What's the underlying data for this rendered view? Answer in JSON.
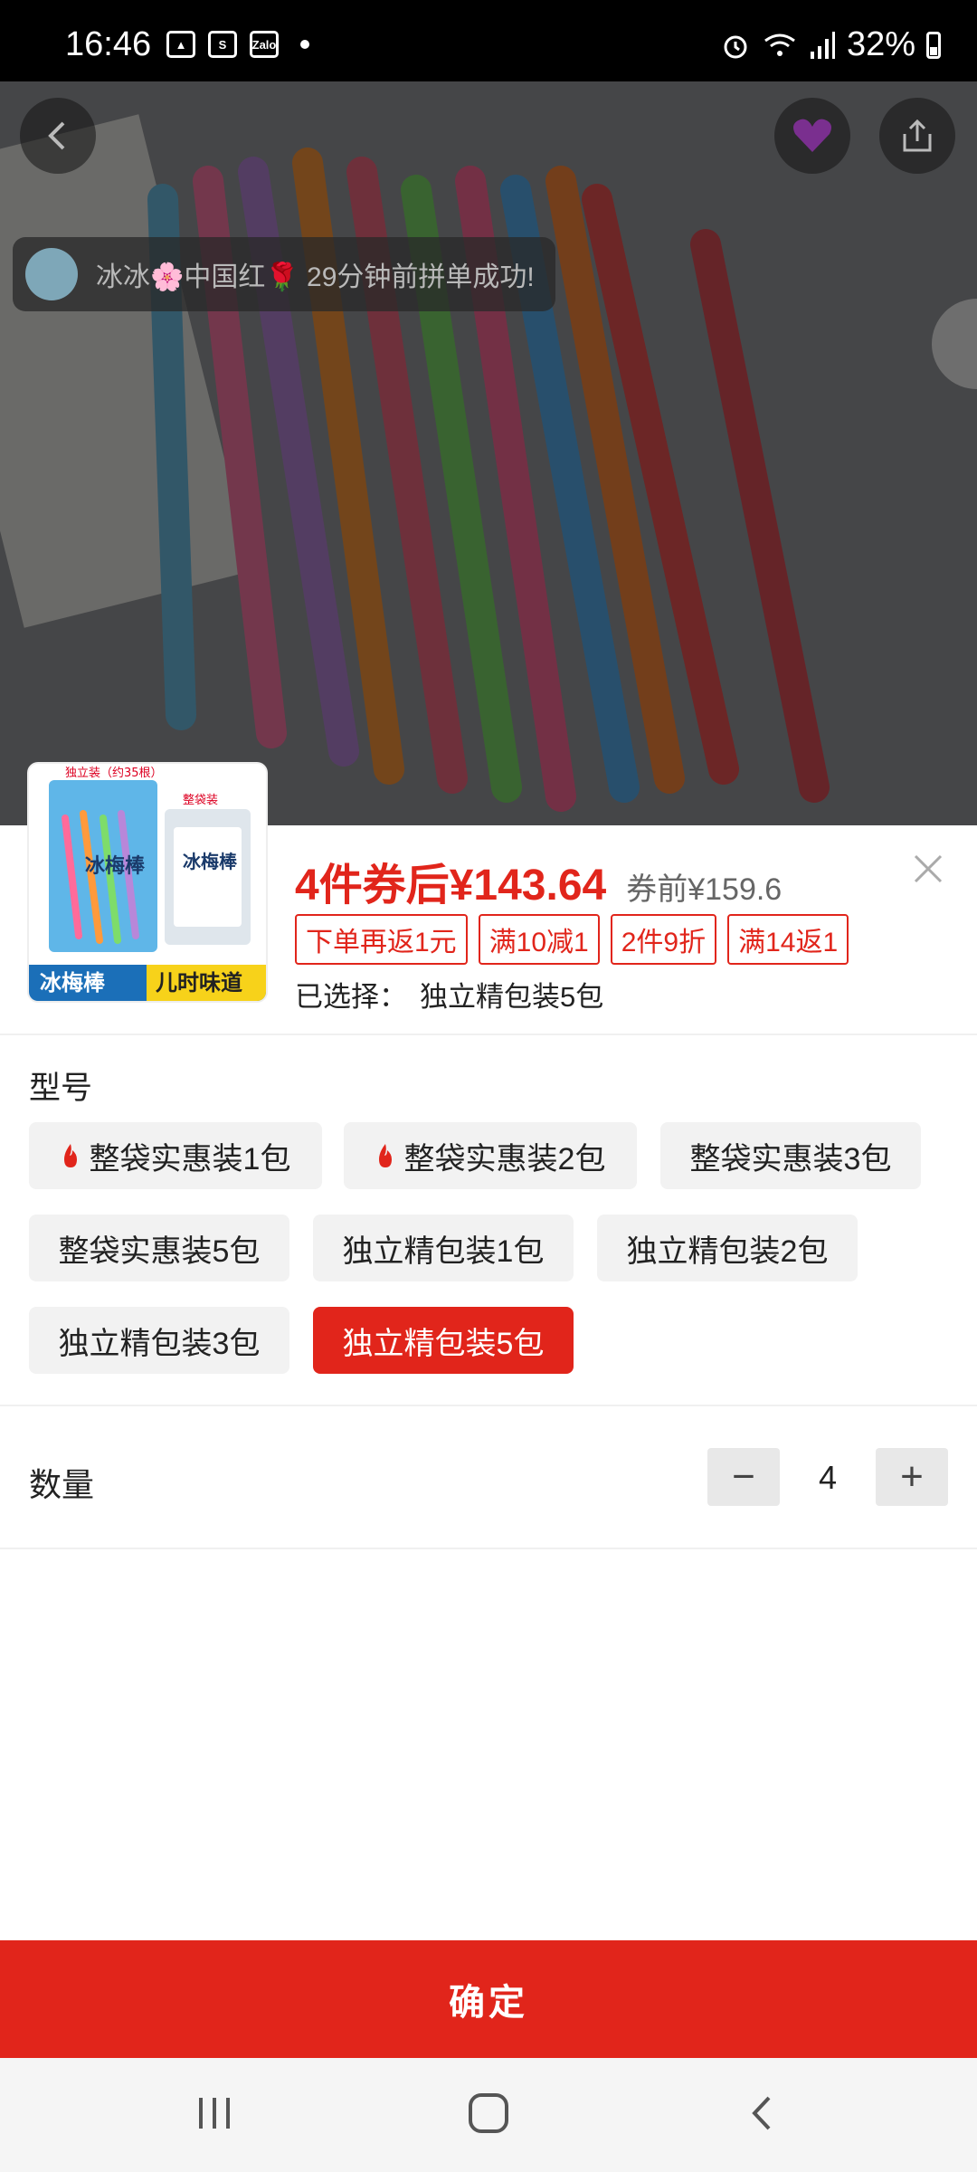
{
  "status_bar": {
    "time": "16:46",
    "battery": "32%"
  },
  "toast": {
    "text": "冰冰🌸中国红🌹 29分钟前拼单成功!"
  },
  "product": {
    "price": "4件券后¥143.64",
    "original_price": "券前¥159.6",
    "tags": [
      "下单再返1元",
      "满10减1",
      "2件9折",
      "满14返1"
    ],
    "selected_label": "已选择：",
    "selected_value": "独立精包装5包",
    "thumb_text": {
      "top": "独立装（约35根）",
      "top_right": "整袋装",
      "brand_left": "冰梅棒",
      "brand_right": "儿时味道",
      "pack_name": "冰梅棒"
    }
  },
  "model": {
    "title": "型号",
    "options": [
      {
        "label": "整袋实惠装1包",
        "hot": true,
        "active": false
      },
      {
        "label": "整袋实惠装2包",
        "hot": true,
        "active": false
      },
      {
        "label": "整袋实惠装3包",
        "hot": false,
        "active": false
      },
      {
        "label": "整袋实惠装5包",
        "hot": false,
        "active": false
      },
      {
        "label": "独立精包装1包",
        "hot": false,
        "active": false
      },
      {
        "label": "独立精包装2包",
        "hot": false,
        "active": false
      },
      {
        "label": "独立精包装3包",
        "hot": false,
        "active": false
      },
      {
        "label": "独立精包装5包",
        "hot": false,
        "active": true
      }
    ]
  },
  "quantity": {
    "label": "数量",
    "value": "4",
    "minus": "−",
    "plus": "+"
  },
  "confirm_label": "确定",
  "colors": {
    "accent": "#e1251b",
    "option_bg": "#f2f2f2"
  },
  "icons": [
    "back-icon",
    "share-icon",
    "close-icon",
    "fire-icon",
    "recent-apps-icon",
    "home-icon",
    "nav-back-icon"
  ]
}
